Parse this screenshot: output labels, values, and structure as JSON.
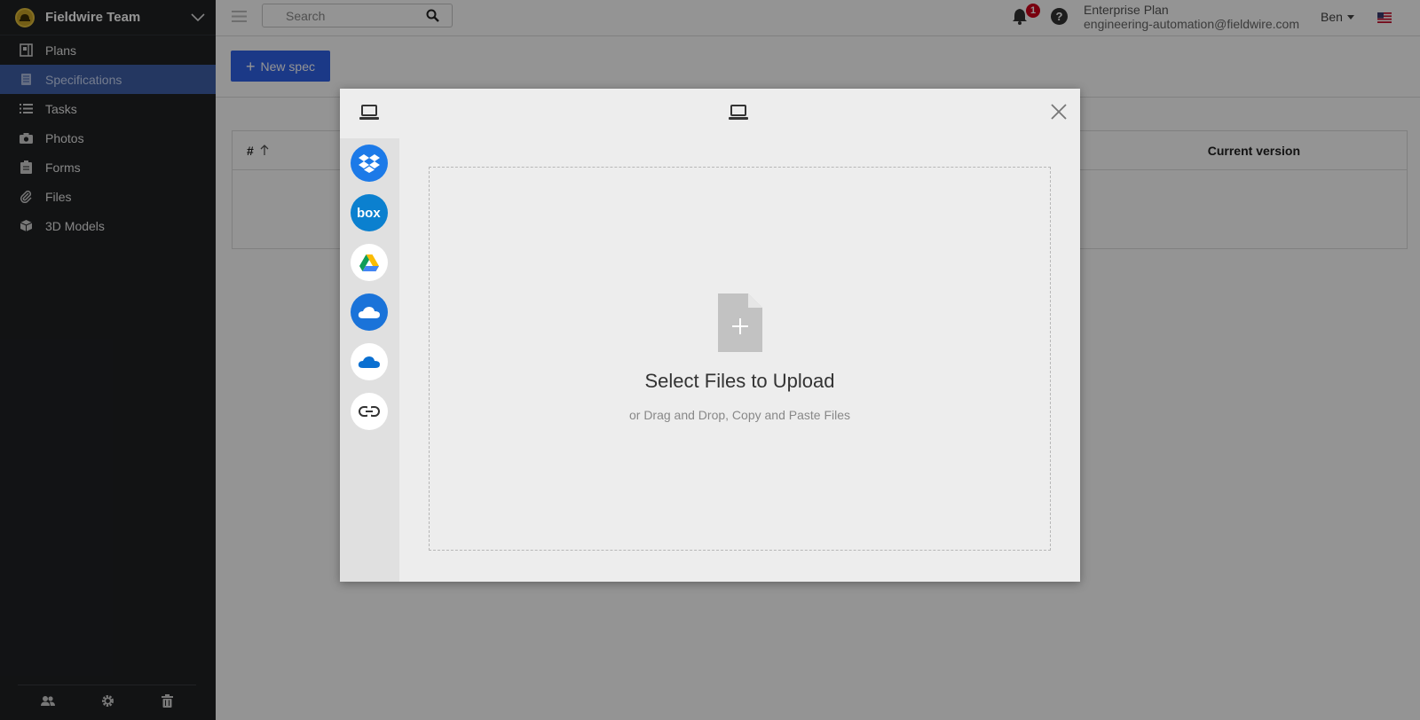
{
  "sidebar": {
    "team_name": "Fieldwire Team",
    "items": [
      {
        "label": "Plans",
        "icon": "plans-icon"
      },
      {
        "label": "Specifications",
        "icon": "specifications-icon",
        "active": true
      },
      {
        "label": "Tasks",
        "icon": "tasks-icon"
      },
      {
        "label": "Photos",
        "icon": "camera-icon"
      },
      {
        "label": "Forms",
        "icon": "clipboard-icon"
      },
      {
        "label": "Files",
        "icon": "paperclip-icon"
      },
      {
        "label": "3D Models",
        "icon": "cube-icon"
      }
    ],
    "footer_icons": [
      "users-icon",
      "gear-icon",
      "trash-icon"
    ],
    "active_color": "#3e5fa7"
  },
  "topbar": {
    "search_placeholder": "Search",
    "notification_count": "1",
    "help_label": "?",
    "plan_name": "Enterprise Plan",
    "email": "engineering-automation@fieldwire.com",
    "user_name": "Ben"
  },
  "main": {
    "new_spec_label": "New spec",
    "table": {
      "col_number": "#",
      "col_current_version": "Current version"
    }
  },
  "modal": {
    "title_icon": "laptop-icon",
    "sources": [
      "dropbox-icon",
      "box-icon",
      "google-drive-icon",
      "onedrive-business-icon",
      "onedrive-icon",
      "link-icon"
    ],
    "dropzone_title": "Select Files to Upload",
    "dropzone_subtitle": "or Drag and Drop, Copy and Paste Files"
  },
  "colors": {
    "brand_blue": "#2f62e8",
    "sidebar_bg": "#1f2124",
    "badge_red": "#d0021b"
  }
}
